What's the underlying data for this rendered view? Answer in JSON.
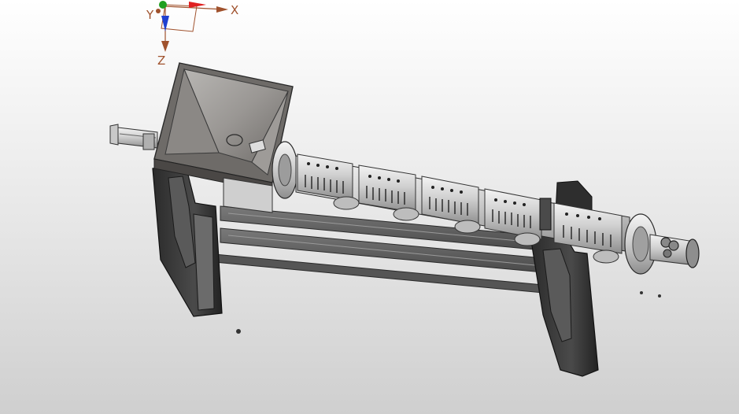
{
  "triad": {
    "x_label": "X",
    "y_label": "Y",
    "z_label": "Z",
    "x_color": "#e02020",
    "y_color": "#20a020",
    "z_color": "#2040d0",
    "label_color": "#a0522d"
  },
  "model": {
    "frame_color": "#3a3a3a",
    "metal_color": "#c8c8c8",
    "hopper_color": "#8a8784"
  }
}
